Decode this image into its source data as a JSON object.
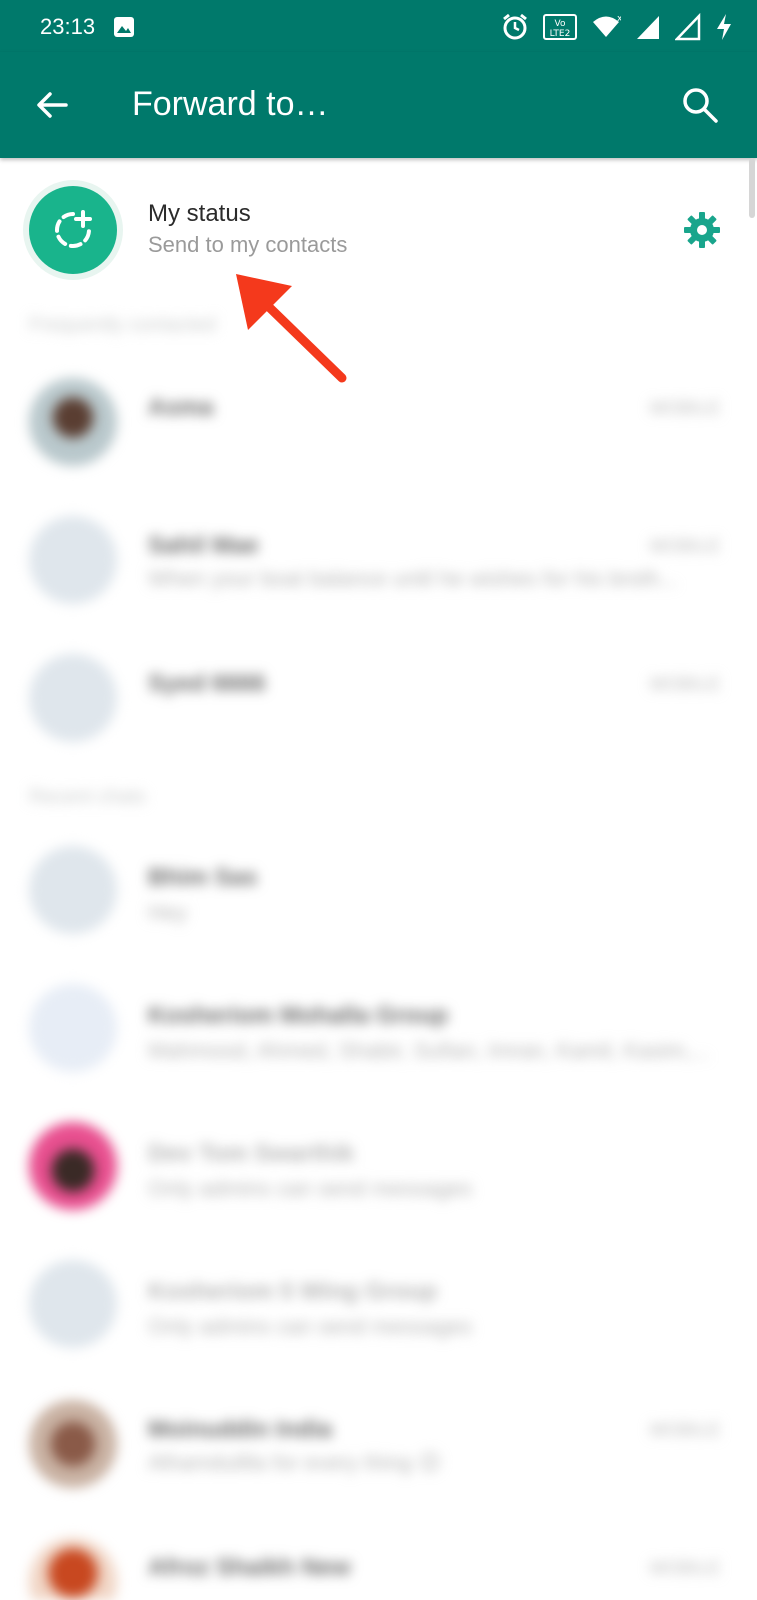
{
  "statusbar": {
    "time": "23:13",
    "network_badge": "Vo LTE2",
    "icons": [
      "gallery-icon",
      "alarm-icon",
      "volte-icon",
      "wifi-icon",
      "signal-icon",
      "signal-icon",
      "charging-icon"
    ]
  },
  "appbar": {
    "title": "Forward to…",
    "back_icon": "arrow-back-icon",
    "search_icon": "search-icon",
    "color": "#00796b"
  },
  "my_status": {
    "name": "My status",
    "subtitle": "Send to my contacts",
    "avatar_color": "#19b48c",
    "settings_icon": "gear-icon"
  },
  "sections": {
    "frequent": "Frequently contacted",
    "recent": "Recent chats"
  },
  "frequent_contacts": [
    {
      "name": "Asma",
      "subtitle": "",
      "tag": "MOBILE"
    },
    {
      "name": "Sahil Mae",
      "subtitle": "When your boat balance until he wishes for his broth...",
      "tag": "MOBILE"
    },
    {
      "name": "Syed 6666",
      "subtitle": "",
      "tag": "MOBILE"
    }
  ],
  "recent_chats": [
    {
      "name": "Bhim Sas",
      "subtitle": "Hey",
      "tag": ""
    },
    {
      "name": "Kosheriom Mohalla Group",
      "subtitle": "Mahmood, Ahmed, Shabir, Sufian, Imran, Kamil, Kasim,...",
      "tag": ""
    },
    {
      "name": "Dev Tom Swarthik",
      "subtitle": "Only admins can send messages",
      "tag": ""
    },
    {
      "name": "Kosheriom 5 Wing Group",
      "subtitle": "Only admins can send messages",
      "tag": ""
    },
    {
      "name": "Moinuddin India",
      "subtitle": "Alhamdulilla for every thing 😊",
      "tag": "MOBILE"
    },
    {
      "name": "Afroz Shaikh New",
      "subtitle": "",
      "tag": "MOBILE"
    }
  ],
  "colors": {
    "accent": "#00796b",
    "status_green": "#19b48c",
    "annotation_arrow": "#f4391c"
  }
}
